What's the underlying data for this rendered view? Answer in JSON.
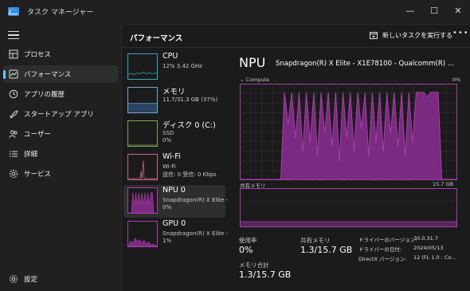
{
  "window": {
    "title": "タスク マネージャー",
    "minimize": "—",
    "maximize": "☐",
    "close": "✕"
  },
  "nav": {
    "items": [
      {
        "label": "プロセス",
        "icon": "grid-icon"
      },
      {
        "label": "パフォーマンス",
        "icon": "performance-icon"
      },
      {
        "label": "アプリの履歴",
        "icon": "history-icon"
      },
      {
        "label": "スタートアップ アプリ",
        "icon": "startup-icon"
      },
      {
        "label": "ユーザー",
        "icon": "users-icon"
      },
      {
        "label": "詳細",
        "icon": "details-icon"
      },
      {
        "label": "サービス",
        "icon": "services-icon"
      }
    ],
    "settings": "設定"
  },
  "header": {
    "title": "パフォーマンス",
    "run_task": "新しいタスクを実行する",
    "more": "•••"
  },
  "devices": [
    {
      "name": "CPU",
      "sub1": "12%  3.42 GHz",
      "sub2": "",
      "sub3": ""
    },
    {
      "name": "メモリ",
      "sub1": "11.7/31.3 GB (37%)",
      "sub2": "",
      "sub3": ""
    },
    {
      "name": "ディスク 0 (C:)",
      "sub1": "SSD",
      "sub2": "0%",
      "sub3": ""
    },
    {
      "name": "Wi-Fi",
      "sub1": "Wi-Fi",
      "sub2": "送信: 0 受信: 0 Kbps",
      "sub3": ""
    },
    {
      "name": "NPU 0",
      "sub1": "Snapdragon(R) X Elite -",
      "sub2": "0%",
      "sub3": ""
    },
    {
      "name": "GPU 0",
      "sub1": "Snapdragon(R) X Elite -",
      "sub2": "1%",
      "sub3": ""
    }
  ],
  "detail": {
    "title": "NPU",
    "model": "Snapdragon(R) X Elite - X1E78100 - Qualcomm(R) ...",
    "compute_label": "Compute",
    "compute_max": "0%",
    "shared_label": "共有メモリ",
    "shared_max": "15.7 GB",
    "stats": {
      "usage_label": "使用率",
      "usage_value": "0%",
      "shared_label": "共有メモリ",
      "shared_value": "1.3/15.7 GB",
      "total_label": "メモリ合計",
      "total_value": "1.3/15.7 GB"
    },
    "info": [
      {
        "key": "ドライバーのバージョン:",
        "value": "30.0.31.7"
      },
      {
        "key": "ドライバーの日付:",
        "value": "2024/05/13"
      },
      {
        "key": "DirectX バージョン:",
        "value": "12 (FL 1.0 : Co..."
      }
    ]
  },
  "colors": {
    "npu": "#a63fa8",
    "npu_fill": "#7a2a80",
    "cpu": "#3fa4c4",
    "memory": "#7aa6d6",
    "disk": "#7fa55a",
    "wifi": "#c86b8a",
    "accent": "#60cdff"
  },
  "chart_data": {
    "type": "area",
    "title": "Compute",
    "ylim": [
      0,
      100
    ],
    "samples": 60,
    "values": [
      0,
      0,
      0,
      0,
      0,
      0,
      0,
      0,
      0,
      0,
      0,
      0,
      95,
      60,
      95,
      45,
      95,
      30,
      95,
      40,
      95,
      25,
      95,
      50,
      95,
      35,
      95,
      20,
      95,
      45,
      95,
      30,
      95,
      55,
      95,
      25,
      95,
      40,
      95,
      30,
      95,
      50,
      95,
      35,
      95,
      25,
      95,
      40,
      95,
      95,
      95,
      90,
      95,
      95,
      95,
      0,
      0,
      0,
      0,
      0
    ]
  }
}
